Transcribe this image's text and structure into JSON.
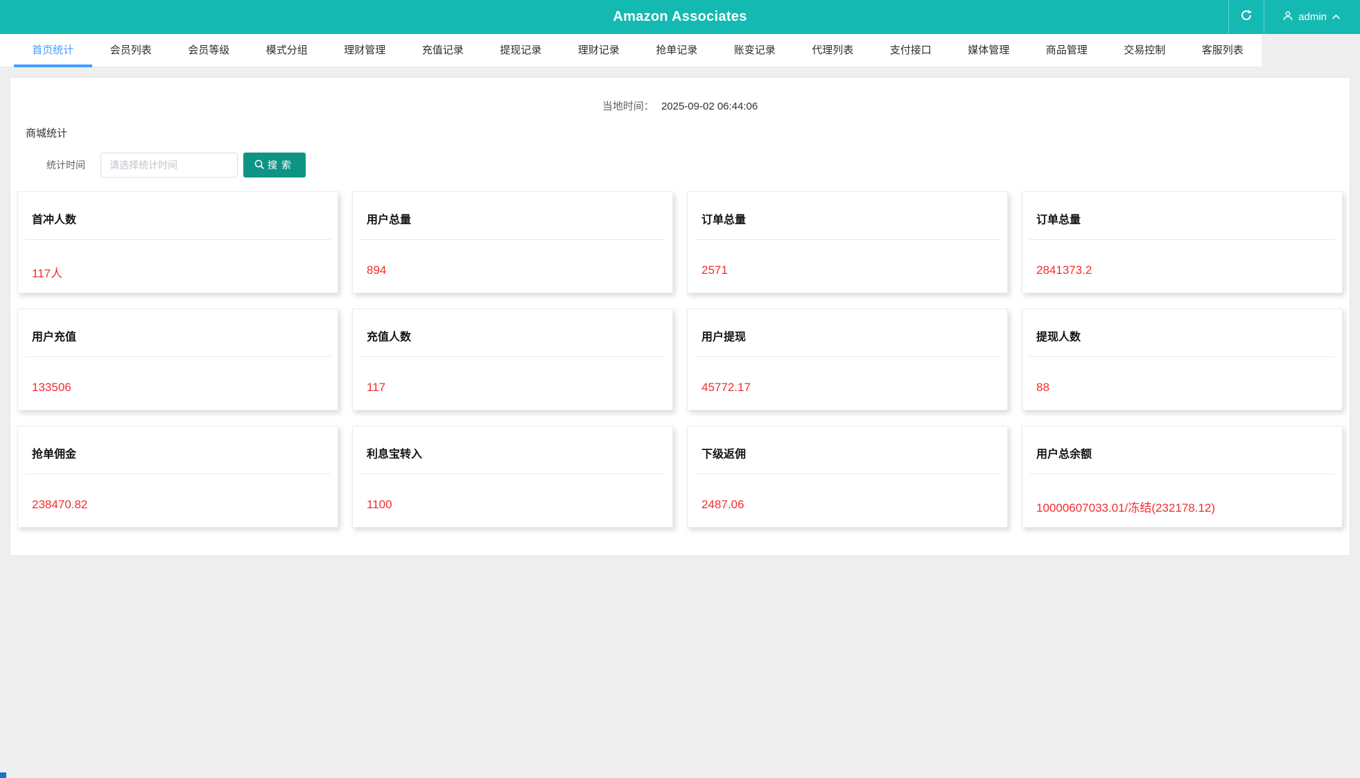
{
  "header": {
    "title": "Amazon Associates",
    "user": "admin"
  },
  "icons": {
    "refresh": "refresh-icon",
    "user": "person-icon",
    "chevron": "chevron-up-icon",
    "search": "search-icon"
  },
  "colors": {
    "header_bg": "#14b9b2",
    "active_tab": "#409eff",
    "value_red": "#f52c2c",
    "search_button_bg": "#0e9485",
    "page_bg": "#efefef"
  },
  "nav": {
    "tabs": [
      {
        "label": "首页统计",
        "active": true
      },
      {
        "label": "会员列表",
        "active": false
      },
      {
        "label": "会员等级",
        "active": false
      },
      {
        "label": "模式分组",
        "active": false
      },
      {
        "label": "理财管理",
        "active": false
      },
      {
        "label": "充值记录",
        "active": false
      },
      {
        "label": "提现记录",
        "active": false
      },
      {
        "label": "理财记录",
        "active": false
      },
      {
        "label": "抢单记录",
        "active": false
      },
      {
        "label": "账变记录",
        "active": false
      },
      {
        "label": "代理列表",
        "active": false
      },
      {
        "label": "支付接口",
        "active": false
      },
      {
        "label": "媒体管理",
        "active": false
      },
      {
        "label": "商品管理",
        "active": false
      },
      {
        "label": "交易控制",
        "active": false
      },
      {
        "label": "客服列表",
        "active": false
      }
    ]
  },
  "main": {
    "local_time_label": "当地时间：",
    "local_time_value": "2025-09-02 06:44:06",
    "section_title": "商城统计",
    "filter": {
      "label": "统计时间",
      "placeholder": "请选择统计时间",
      "search_label": "搜索"
    },
    "stats": [
      {
        "title": "首冲人数",
        "value": "117人"
      },
      {
        "title": "用户总量",
        "value": "894"
      },
      {
        "title": "订单总量",
        "value": "2571"
      },
      {
        "title": "订单总量",
        "value": "2841373.2"
      },
      {
        "title": "用户充值",
        "value": "133506"
      },
      {
        "title": "充值人数",
        "value": "117"
      },
      {
        "title": "用户提现",
        "value": "45772.17"
      },
      {
        "title": "提现人数",
        "value": "88"
      },
      {
        "title": "抢单佣金",
        "value": "238470.82"
      },
      {
        "title": "利息宝转入",
        "value": "1100"
      },
      {
        "title": "下级返佣",
        "value": "2487.06"
      },
      {
        "title": "用户总余额",
        "value": "10000607033.01/冻结(232178.12)"
      }
    ]
  }
}
